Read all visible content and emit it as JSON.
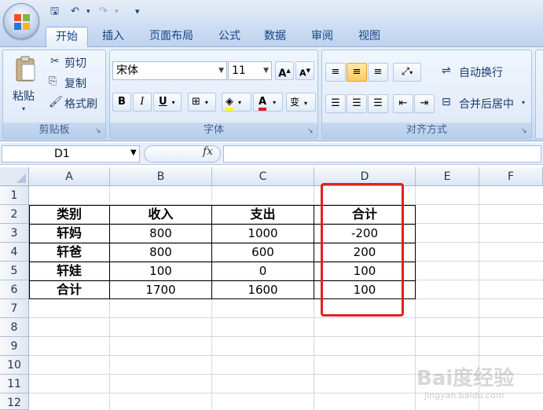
{
  "quick_access": {
    "save": "🖫",
    "undo": "↶",
    "redo": "↷",
    "more": "▾"
  },
  "tabs": [
    {
      "label": "开始",
      "active": true
    },
    {
      "label": "插入"
    },
    {
      "label": "页面布局"
    },
    {
      "label": "公式"
    },
    {
      "label": "数据"
    },
    {
      "label": "审阅"
    },
    {
      "label": "视图"
    }
  ],
  "clipboard": {
    "paste": "粘贴",
    "cut": "剪切",
    "copy": "复制",
    "format_painter": "格式刷",
    "group_label": "剪贴板"
  },
  "font": {
    "name": "宋体",
    "size": "11",
    "grow": "A",
    "shrink": "A",
    "bold": "B",
    "italic": "I",
    "underline": "U",
    "group_label": "字体",
    "phonetic": "变"
  },
  "alignment": {
    "wrap_text": "自动换行",
    "merge_center": "合并后居中",
    "group_label": "对齐方式"
  },
  "formula_bar": {
    "name_box": "D1",
    "fx": "fx",
    "value": ""
  },
  "columns": [
    "A",
    "B",
    "C",
    "D",
    "E",
    "F"
  ],
  "rows": [
    "1",
    "2",
    "3",
    "4",
    "5",
    "6",
    "7",
    "8",
    "9",
    "10",
    "11",
    "12"
  ],
  "table": {
    "headers": [
      "类别",
      "收入",
      "支出",
      "合计"
    ],
    "rows": [
      [
        "轩妈",
        "800",
        "1000",
        "-200"
      ],
      [
        "轩爸",
        "800",
        "600",
        "200"
      ],
      [
        "轩娃",
        "100",
        "0",
        "100"
      ],
      [
        "合计",
        "1700",
        "1600",
        "100"
      ]
    ]
  },
  "watermark": {
    "main": "Bai度经验",
    "sub": "jingyan.baidu.com"
  },
  "colors": {
    "highlight": "#e0201e",
    "ribbon": "#d7e4f5",
    "accent": "#15428b"
  }
}
